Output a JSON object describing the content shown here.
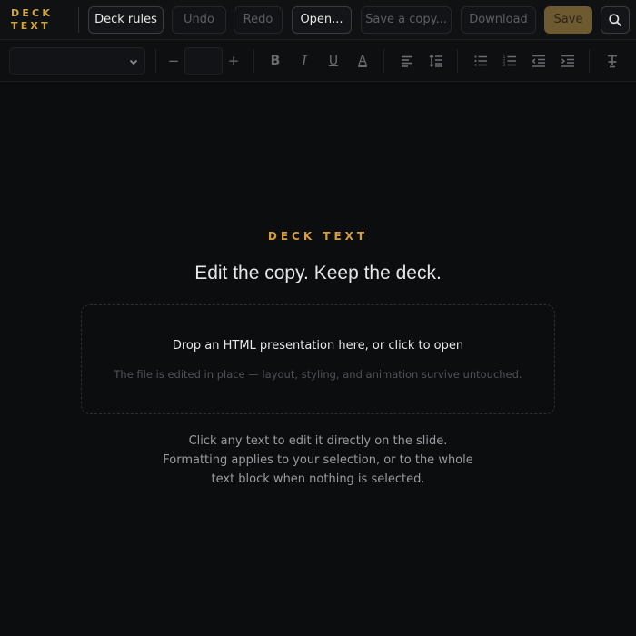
{
  "logo": {
    "line1": "DECK",
    "line2": "TEXT"
  },
  "toolbar": {
    "deck_rules": "Deck rules",
    "undo": "Undo",
    "redo": "Redo",
    "open": "Open...",
    "save_copy": "Save a copy...",
    "download": "Download",
    "save": "Save"
  },
  "format": {
    "font_value": "",
    "size_value": "",
    "decrease": "−",
    "increase": "+",
    "bold": "B",
    "italic": "I",
    "underline": "U",
    "color": "A"
  },
  "hero": {
    "eyebrow": "DECK TEXT",
    "headline": "Edit the copy. Keep the deck."
  },
  "dropzone": {
    "title": "Drop an HTML presentation here, or click to open",
    "subtitle": "The file is edited in place — layout, styling, and animation survive untouched."
  },
  "help": {
    "line1": "Click any text to edit it directly on the slide.",
    "line2": "Formatting applies to your selection, or to the whole",
    "line3": "text block when nothing is selected."
  },
  "colors": {
    "accent": "#d69e3a",
    "save_button": "#6e5a30",
    "background": "#0c0d0f"
  },
  "icons": [
    "chevron-down-icon",
    "align-left-icon",
    "line-height-icon",
    "bullet-list-icon",
    "numbered-list-icon",
    "outdent-icon",
    "indent-icon",
    "clear-format-icon",
    "search-icon"
  ]
}
